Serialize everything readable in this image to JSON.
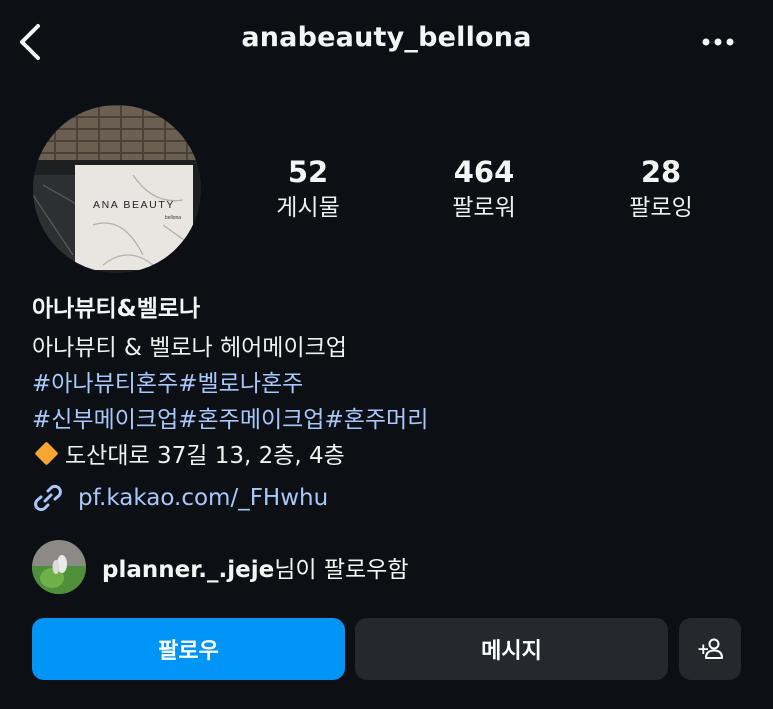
{
  "header": {
    "username": "anabeauty_bellona"
  },
  "stats": [
    {
      "value": "52",
      "label": "게시물"
    },
    {
      "value": "464",
      "label": "팔로워"
    },
    {
      "value": "28",
      "label": "팔로잉"
    }
  ],
  "bio": {
    "name": "아나뷰티&벨로나",
    "description": "아나뷰티 & 벨로나 헤어메이크업",
    "hashtags_line1": "#아나뷰티혼주#벨로나혼주",
    "hashtags_line2": "#신부메이크업#혼주메이크업#혼주머리",
    "address": "도산대로 37길 13, 2층, 4층",
    "link": "pf.kakao.com/_FHwhu"
  },
  "avatar": {
    "sign_text": "ANA BEAUTY",
    "sign_sub": "bellona"
  },
  "followed_by": {
    "username": "planner._.jeje",
    "suffix": "님이 팔로우함"
  },
  "actions": {
    "follow": "팔로우",
    "message": "메시지",
    "add_person": "+"
  },
  "colors": {
    "background": "#0c1014",
    "link": "#a8c7fa",
    "follow_button": "#0095f6",
    "secondary_button": "#25292e"
  },
  "icons": [
    "back-chevron-icon",
    "more-dots-icon",
    "link-chain-icon",
    "diamond-icon",
    "add-person-icon"
  ]
}
